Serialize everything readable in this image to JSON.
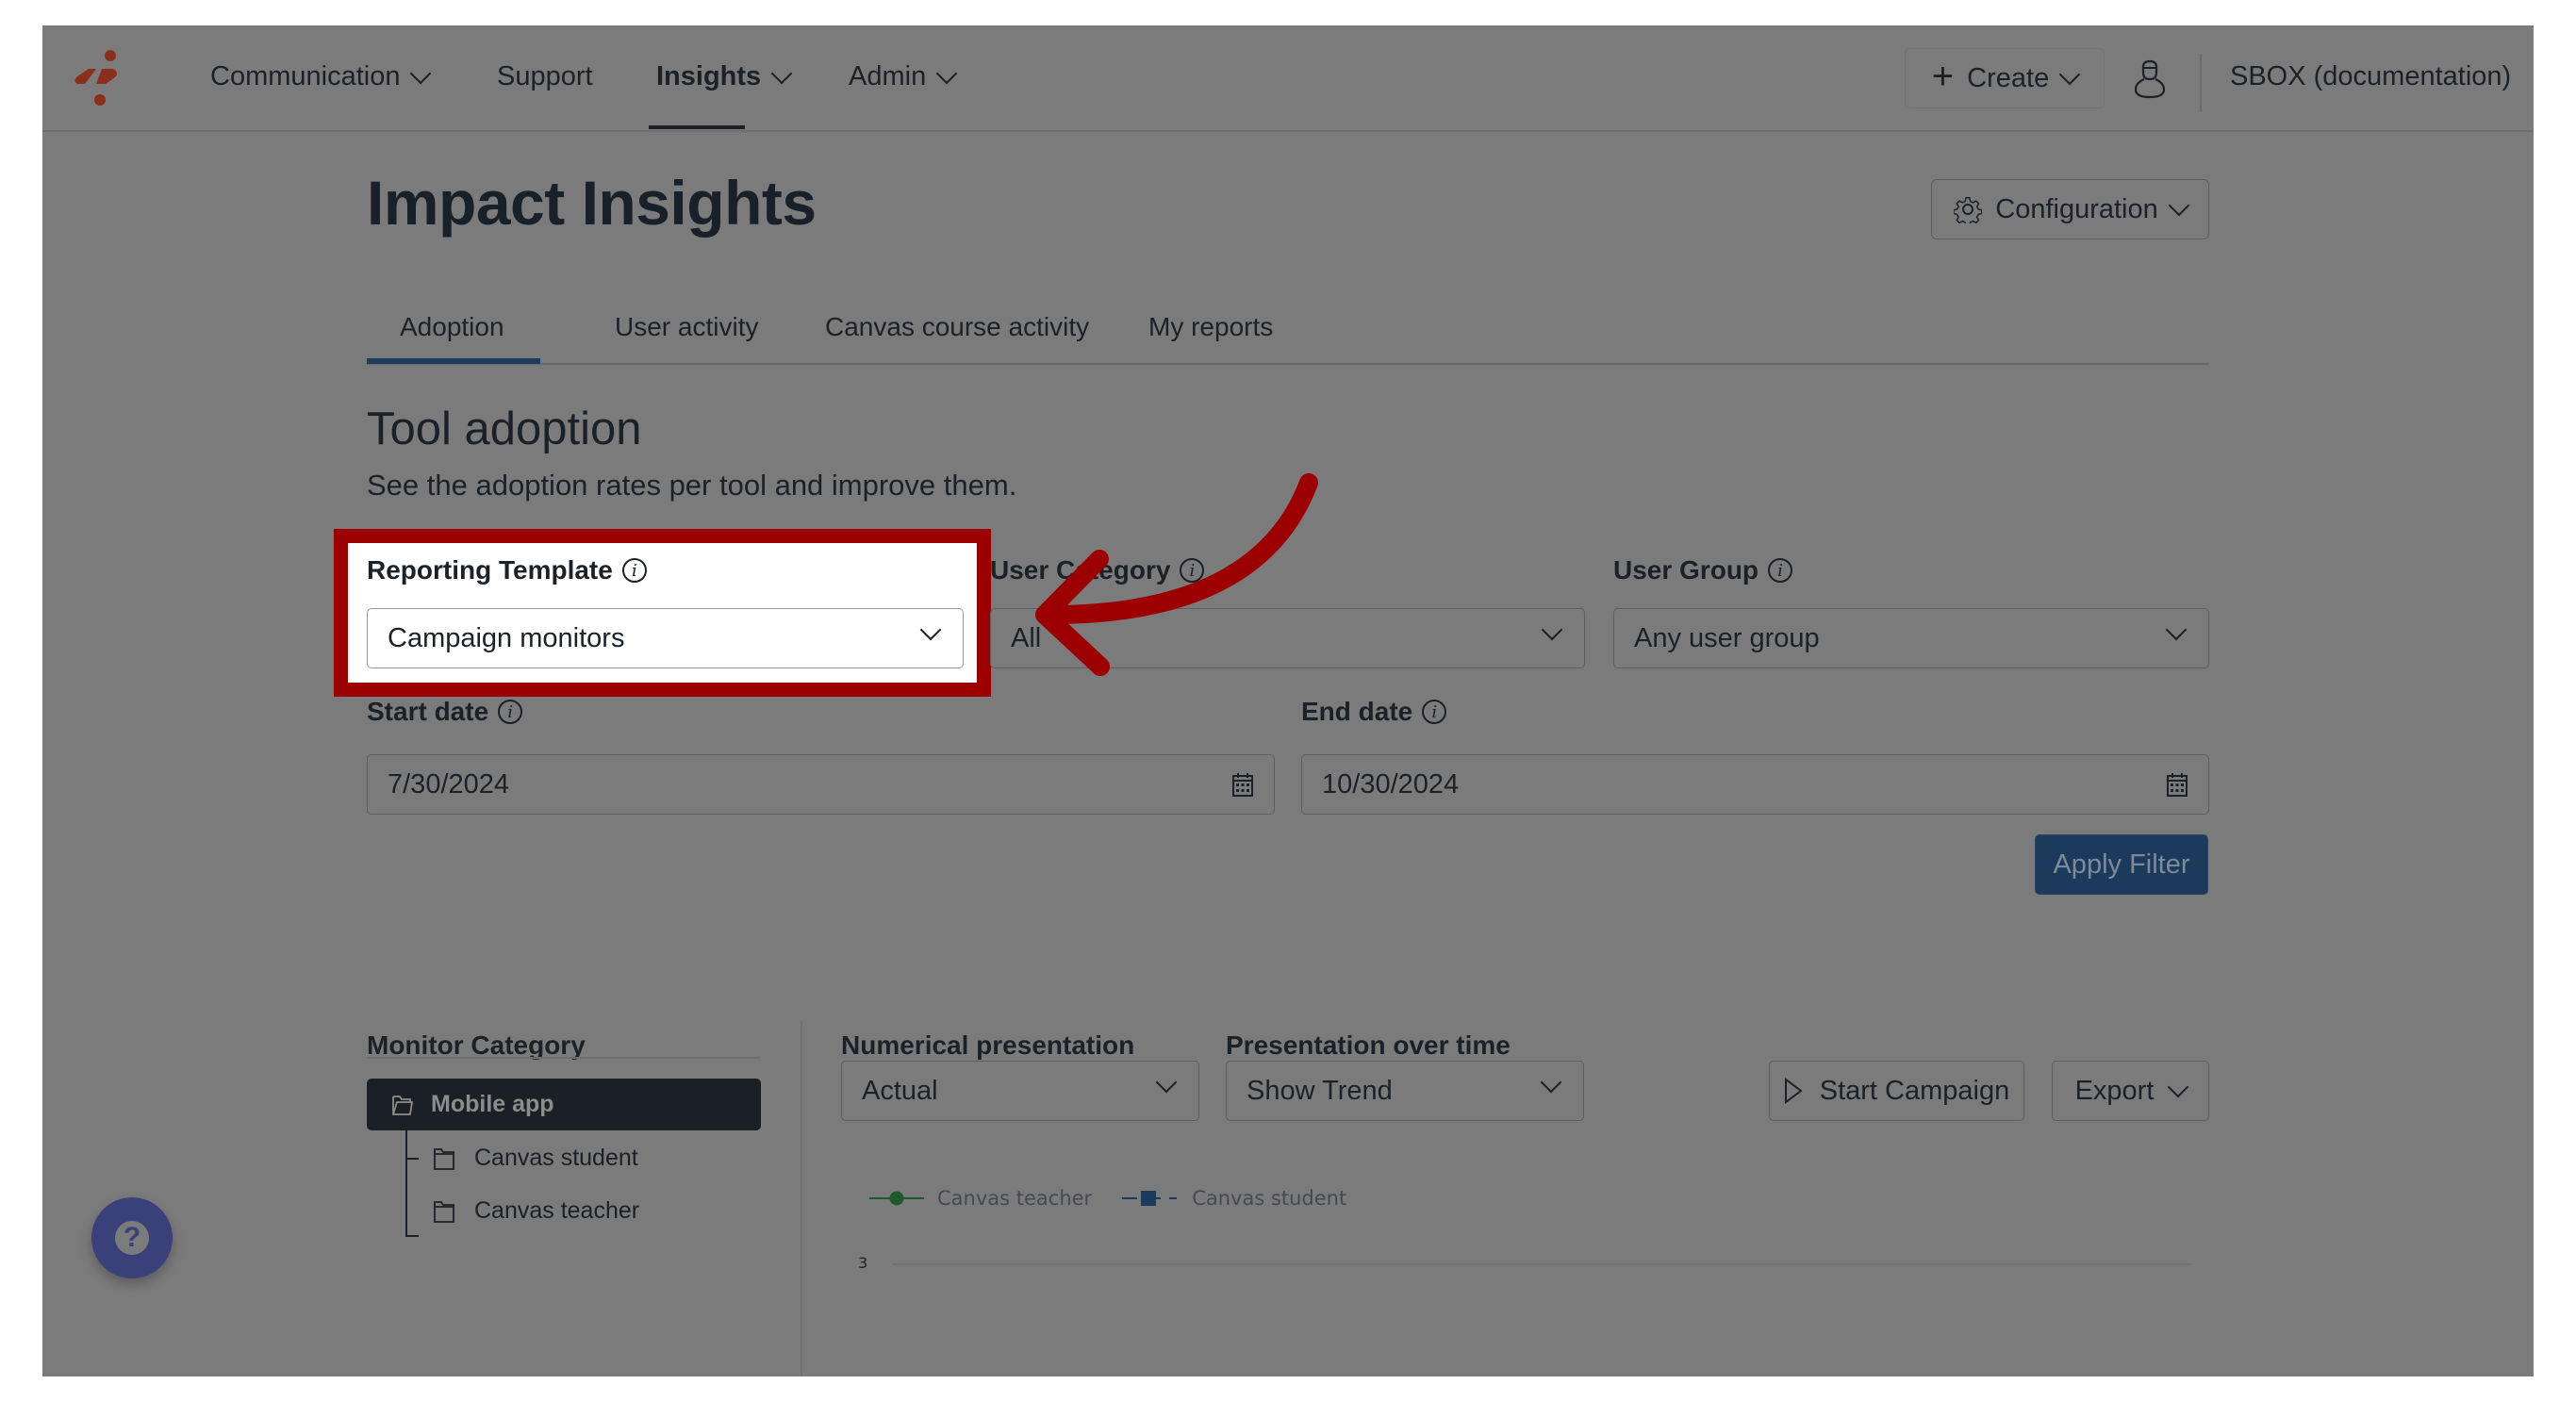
{
  "nav": {
    "items": [
      {
        "label": "Communication",
        "has_dropdown": true
      },
      {
        "label": "Support",
        "has_dropdown": false
      },
      {
        "label": "Insights",
        "has_dropdown": true,
        "active": true
      },
      {
        "label": "Admin",
        "has_dropdown": true
      }
    ],
    "create_label": "Create",
    "account_label": "SBOX (documentation)"
  },
  "page": {
    "title": "Impact Insights",
    "configuration_label": "Configuration",
    "tabs": [
      {
        "label": "Adoption",
        "active": true
      },
      {
        "label": "User activity"
      },
      {
        "label": "Canvas course activity"
      },
      {
        "label": "My reports"
      }
    ],
    "section_title": "Tool adoption",
    "section_subtitle": "See the adoption rates per tool and improve them."
  },
  "filters": {
    "reporting_template": {
      "label": "Reporting Template",
      "value": "Campaign monitors"
    },
    "user_category": {
      "label": "User Category",
      "value": "All"
    },
    "user_group": {
      "label": "User Group",
      "value": "Any user group"
    },
    "start_date": {
      "label": "Start date",
      "value": "7/30/2024"
    },
    "end_date": {
      "label": "End date",
      "value": "10/30/2024"
    },
    "apply_label": "Apply Filter"
  },
  "monitor": {
    "label": "Monitor Category",
    "active_item": "Mobile app",
    "children": [
      "Canvas student",
      "Canvas teacher"
    ]
  },
  "presentation": {
    "numerical_label": "Numerical presentation",
    "numerical_value": "Actual",
    "over_time_label": "Presentation over time",
    "over_time_value": "Show Trend",
    "start_campaign_label": "Start Campaign",
    "export_label": "Export"
  },
  "chart": {
    "legend": [
      {
        "name": "Canvas teacher",
        "color": "#1f5a2c",
        "marker": "circle"
      },
      {
        "name": "Canvas student",
        "color": "#1b3a5c",
        "marker": "square"
      }
    ],
    "y_tick_top": "3"
  },
  "colors": {
    "highlight": "#9c0000",
    "overlay": "#7b7b7b",
    "brand": "#8a2f1c"
  }
}
